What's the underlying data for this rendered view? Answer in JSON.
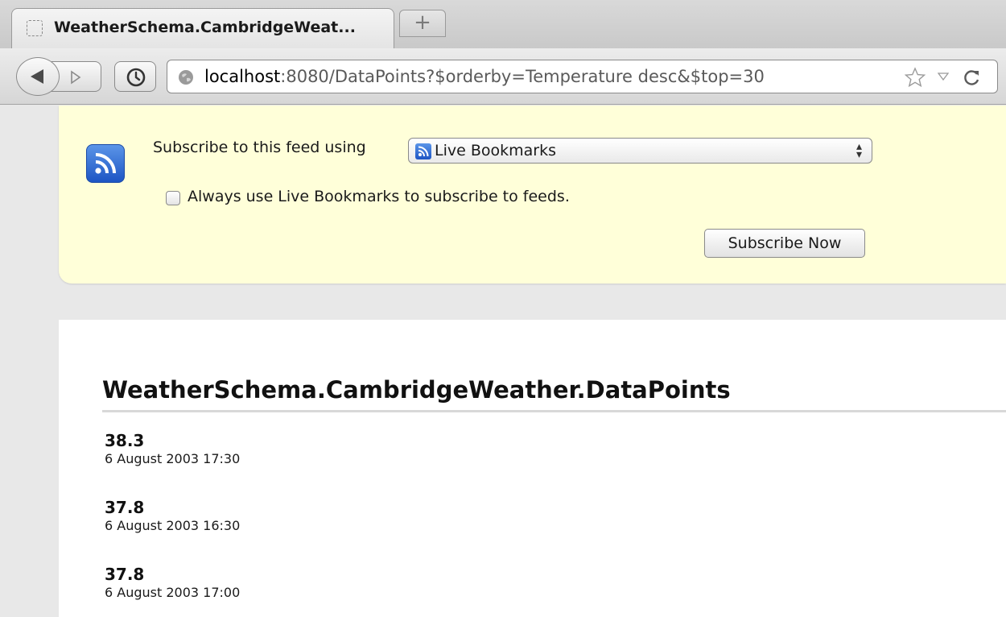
{
  "tab": {
    "title": "WeatherSchema.CambridgeWeat...",
    "new_tab": "+"
  },
  "urlbar": {
    "host": "localhost",
    "rest": ":8080/DataPoints?$orderby=Temperature desc&$top=30"
  },
  "feed": {
    "subscribe_label": "Subscribe to this feed using",
    "reader_selected": "Live Bookmarks",
    "always_label": "Always use Live Bookmarks to subscribe to feeds.",
    "always_checked": false,
    "subscribe_button": "Subscribe Now",
    "title": "WeatherSchema.CambridgeWeather.DataPoints",
    "entries": [
      {
        "value": "38.3",
        "date": "6 August 2003 17:30"
      },
      {
        "value": "37.8",
        "date": "6 August 2003 16:30"
      },
      {
        "value": "37.8",
        "date": "6 August 2003 17:00"
      }
    ]
  },
  "colors": {
    "feed_box_bg": "#ffffd9",
    "feed_icon": "#2a66d4"
  },
  "icons": {
    "tab_favicon": "placeholder-favicon-icon",
    "back": "back-arrow-icon",
    "forward": "forward-arrow-icon",
    "history": "clock-icon",
    "site": "globe-icon",
    "bookmark": "star-icon",
    "reload": "reload-icon",
    "feed": "rss-feed-icon"
  }
}
